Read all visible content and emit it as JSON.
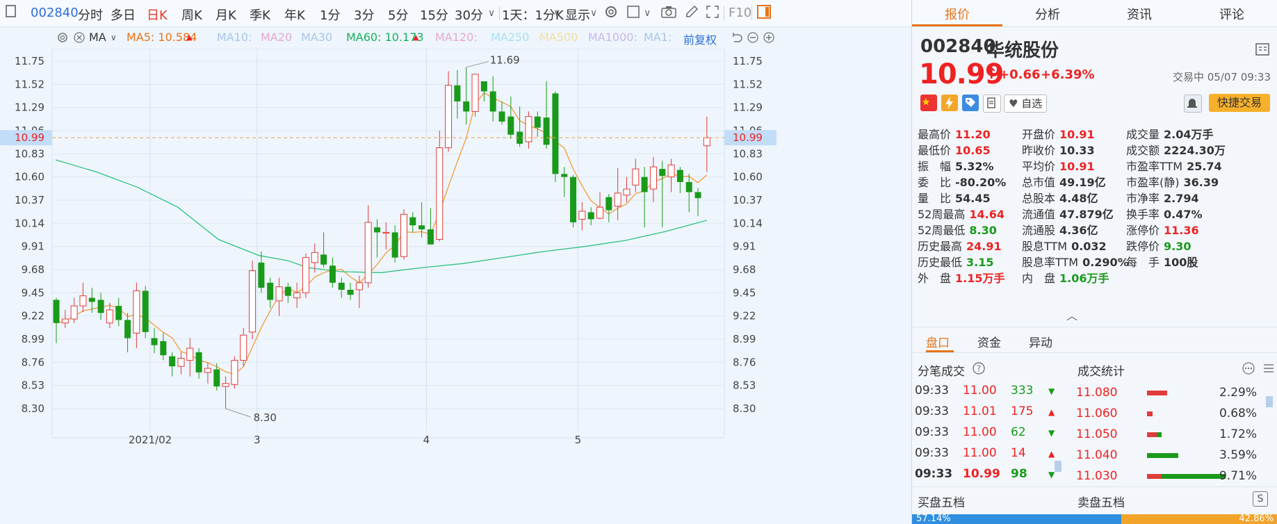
{
  "toolbar": {
    "code": "002840",
    "periods": [
      "分时",
      "多日",
      "日K",
      "周K",
      "月K",
      "季K",
      "年K",
      "1分",
      "3分",
      "5分",
      "15分",
      "30分"
    ],
    "active_period": "日K",
    "interval_select": "1天：1分K",
    "display_menu": "显示",
    "f10": "F10"
  },
  "ma_row": {
    "type_select": "MA",
    "ma5": "MA5: 10.584",
    "ma10": "MA10:",
    "ma20": "MA20",
    "ma30": "MA30",
    "ma60": "MA60: 10.173",
    "ma120": "MA120:",
    "ma250": "MA250",
    "ma500": "MA500",
    "ma1000": "MA1000:",
    "ma1": "MA1:",
    "adjust": "前复权",
    "colors": {
      "ma5": "#e8731a",
      "ma60": "#19b05e",
      "faded": "#a9c6ea",
      "faded_pink": "#e6a9c8"
    }
  },
  "chart_data": {
    "type": "candlestick",
    "y_ticks": [
      11.75,
      11.52,
      11.29,
      11.06,
      10.83,
      10.6,
      10.37,
      10.14,
      9.91,
      9.68,
      9.45,
      9.22,
      8.99,
      8.76,
      8.53,
      8.3
    ],
    "ylim": [
      8.22,
      11.84
    ],
    "x_labels": [
      {
        "label": "2021/02",
        "index": 11
      },
      {
        "label": "3",
        "index": 23
      },
      {
        "label": "4",
        "index": 42
      },
      {
        "label": "5",
        "index": 59
      }
    ],
    "annotations": {
      "high": "11.69",
      "low": "8.30"
    },
    "current_price": "10.99",
    "candles": [
      [
        9.38,
        9.15,
        9.4,
        8.95
      ],
      [
        9.15,
        9.19,
        9.28,
        9.1
      ],
      [
        9.19,
        9.32,
        9.4,
        9.15
      ],
      [
        9.32,
        9.42,
        9.55,
        9.26
      ],
      [
        9.4,
        9.36,
        9.5,
        9.25
      ],
      [
        9.38,
        9.25,
        9.45,
        9.18
      ],
      [
        9.15,
        9.28,
        9.35,
        9.1
      ],
      [
        9.32,
        9.18,
        9.4,
        9.12
      ],
      [
        9.18,
        9.0,
        9.25,
        8.86
      ],
      [
        9.05,
        9.47,
        9.55,
        8.9
      ],
      [
        9.47,
        9.06,
        9.52,
        9.0
      ],
      [
        9.0,
        8.93,
        9.1,
        8.85
      ],
      [
        8.97,
        8.83,
        9.05,
        8.78
      ],
      [
        8.82,
        8.72,
        8.86,
        8.62
      ],
      [
        8.72,
        8.8,
        8.86,
        8.64
      ],
      [
        8.78,
        8.9,
        9.0,
        8.62
      ],
      [
        8.86,
        8.66,
        8.9,
        8.6
      ],
      [
        8.66,
        8.7,
        8.76,
        8.55
      ],
      [
        8.69,
        8.52,
        8.75,
        8.48
      ],
      [
        8.52,
        8.55,
        8.62,
        8.3
      ],
      [
        8.54,
        8.78,
        8.82,
        8.5
      ],
      [
        8.78,
        9.03,
        9.1,
        8.72
      ],
      [
        9.06,
        9.67,
        9.77,
        8.99
      ],
      [
        9.75,
        9.5,
        9.86,
        9.45
      ],
      [
        9.55,
        9.38,
        9.6,
        9.3
      ],
      [
        9.37,
        9.51,
        9.6,
        9.22
      ],
      [
        9.51,
        9.42,
        9.55,
        9.35
      ],
      [
        9.4,
        9.45,
        9.55,
        9.3
      ],
      [
        9.45,
        9.8,
        9.84,
        9.4
      ],
      [
        9.75,
        9.85,
        9.94,
        9.65
      ],
      [
        9.83,
        9.73,
        10.05,
        9.7
      ],
      [
        9.72,
        9.55,
        9.8,
        9.5
      ],
      [
        9.55,
        9.48,
        9.6,
        9.4
      ],
      [
        9.48,
        9.43,
        9.55,
        9.38
      ],
      [
        9.48,
        9.55,
        9.62,
        9.3
      ],
      [
        9.55,
        10.15,
        10.32,
        9.5
      ],
      [
        10.1,
        10.05,
        10.18,
        9.8
      ],
      [
        10.05,
        10.05,
        10.15,
        9.88
      ],
      [
        10.05,
        9.8,
        10.12,
        9.75
      ],
      [
        9.81,
        10.23,
        10.28,
        9.78
      ],
      [
        10.2,
        10.12,
        10.25,
        10.05
      ],
      [
        10.12,
        10.08,
        10.35,
        10.0
      ],
      [
        10.08,
        9.93,
        10.29,
        9.95
      ],
      [
        9.98,
        10.89,
        11.06,
        9.96
      ],
      [
        10.89,
        11.51,
        11.65,
        10.85
      ],
      [
        11.51,
        11.35,
        11.66,
        11.18
      ],
      [
        11.35,
        11.25,
        11.69,
        11.12
      ],
      [
        11.25,
        11.62,
        11.62,
        11.2
      ],
      [
        11.55,
        11.45,
        11.55,
        11.35
      ],
      [
        11.45,
        11.25,
        11.6,
        11.15
      ],
      [
        11.25,
        11.15,
        11.35,
        11.12
      ],
      [
        11.2,
        11.02,
        11.4,
        10.98
      ],
      [
        11.05,
        10.93,
        11.3,
        10.9
      ],
      [
        10.95,
        11.2,
        11.25,
        10.88
      ],
      [
        11.2,
        11.09,
        11.25,
        11.0
      ],
      [
        11.19,
        10.92,
        11.55,
        10.88
      ],
      [
        11.43,
        10.63,
        11.45,
        10.55
      ],
      [
        10.63,
        10.6,
        10.7,
        10.4
      ],
      [
        10.6,
        10.15,
        10.62,
        10.1
      ],
      [
        10.18,
        10.26,
        10.35,
        10.07
      ],
      [
        10.25,
        10.18,
        10.3,
        10.12
      ],
      [
        10.19,
        10.3,
        10.45,
        10.18
      ],
      [
        10.4,
        10.27,
        10.43,
        10.15
      ],
      [
        10.31,
        10.44,
        10.69,
        10.17
      ],
      [
        10.42,
        10.48,
        10.6,
        10.35
      ],
      [
        10.52,
        10.68,
        10.78,
        10.45
      ],
      [
        10.6,
        10.45,
        10.7,
        10.1
      ],
      [
        10.48,
        10.7,
        10.8,
        10.35
      ],
      [
        10.68,
        10.61,
        10.76,
        10.1
      ],
      [
        10.6,
        10.72,
        10.78,
        10.45
      ],
      [
        10.67,
        10.55,
        10.7,
        10.44
      ],
      [
        10.55,
        10.45,
        10.63,
        10.25
      ],
      [
        10.45,
        10.39,
        10.49,
        10.21
      ],
      [
        10.91,
        10.99,
        11.2,
        10.65
      ]
    ],
    "ma60_points": [
      [
        0,
        10.77
      ],
      [
        10,
        10.65
      ],
      [
        20,
        10.5
      ],
      [
        30,
        10.3
      ],
      [
        40,
        9.98
      ],
      [
        50,
        9.82
      ],
      [
        57,
        9.77
      ],
      [
        62,
        9.7
      ],
      [
        70,
        9.66
      ],
      [
        80,
        9.65
      ],
      [
        90,
        9.7
      ],
      [
        100,
        9.74
      ],
      [
        110,
        9.8
      ],
      [
        120,
        9.86
      ],
      [
        130,
        9.91
      ],
      [
        140,
        9.97
      ],
      [
        150,
        10.06
      ],
      [
        160,
        10.17
      ]
    ]
  },
  "right_panel": {
    "tabs": [
      "报价",
      "分析",
      "资讯",
      "评论"
    ],
    "active_tab": "报价",
    "code": "002840",
    "name": "华统股份",
    "price": "10.99",
    "change": "+0.66",
    "change_pct": "+6.39%",
    "state": "交易中 05/07 09:33",
    "watch_button": "自选",
    "quick_trade": "快捷交易",
    "stats_col1": [
      {
        "k": "最高价",
        "v": "11.20",
        "c": "red"
      },
      {
        "k": "最低价",
        "v": "10.65",
        "c": "red"
      },
      {
        "k": "振　幅",
        "v": "5.32%",
        "c": "dark"
      },
      {
        "k": "委　比",
        "v": "-80.20%",
        "c": "dark"
      },
      {
        "k": "量　比",
        "v": "54.45",
        "c": "dark"
      },
      {
        "k": "52周最高",
        "v": "14.64",
        "c": "red"
      },
      {
        "k": "52周最低",
        "v": "8.30",
        "c": "green"
      },
      {
        "k": "历史最高",
        "v": "24.91",
        "c": "red"
      },
      {
        "k": "历史最低",
        "v": "3.15",
        "c": "green"
      },
      {
        "k": "外　盘",
        "v": "1.15万手",
        "c": "red"
      }
    ],
    "stats_col2": [
      {
        "k": "开盘价",
        "v": "10.91",
        "c": "red"
      },
      {
        "k": "昨收价",
        "v": "10.33",
        "c": "dark"
      },
      {
        "k": "平均价",
        "v": "10.91",
        "c": "red"
      },
      {
        "k": "总市值",
        "v": "49.19亿",
        "c": "dark"
      },
      {
        "k": "总股本",
        "v": "4.48亿",
        "c": "dark"
      },
      {
        "k": "流通值",
        "v": "47.879亿",
        "c": "dark"
      },
      {
        "k": "流通股",
        "v": "4.36亿",
        "c": "dark"
      },
      {
        "k": "股息TTM",
        "v": "0.032",
        "c": "dark"
      },
      {
        "k": "股息率TTM",
        "v": "0.290%",
        "c": "dark"
      },
      {
        "k": "内　盘",
        "v": "1.06万手",
        "c": "green"
      }
    ],
    "stats_col3": [
      {
        "k": "成交量",
        "v": "2.04万手",
        "c": "dark"
      },
      {
        "k": "成交额",
        "v": "2224.30万",
        "c": "dark"
      },
      {
        "k": "市盈率TTM",
        "v": "25.74",
        "c": "dark"
      },
      {
        "k": "市盈率(静)",
        "v": "36.39",
        "c": "dark"
      },
      {
        "k": "市净率",
        "v": "2.794",
        "c": "dark"
      },
      {
        "k": "换手率",
        "v": "0.47%",
        "c": "dark"
      },
      {
        "k": "涨停价",
        "v": "11.36",
        "c": "red"
      },
      {
        "k": "跌停价",
        "v": "9.30",
        "c": "green"
      },
      {
        "k": "每　手",
        "v": "100股",
        "c": "dark"
      }
    ],
    "sub_tabs": [
      "盘口",
      "资金",
      "异动"
    ],
    "active_sub_tab": "盘口",
    "ticks_title": "分笔成交",
    "ticks": [
      {
        "time": "09:33",
        "price": "11.00",
        "vol": "333",
        "dir": "down"
      },
      {
        "time": "09:33",
        "price": "11.01",
        "vol": "175",
        "dir": "up"
      },
      {
        "time": "09:33",
        "price": "11.00",
        "vol": "62",
        "dir": "down"
      },
      {
        "time": "09:33",
        "price": "11.00",
        "vol": "14",
        "dir": "up"
      },
      {
        "time": "09:33",
        "price": "10.99",
        "vol": "98",
        "dir": "down"
      }
    ],
    "volstats_title": "成交统计",
    "volstats": [
      {
        "price": "11.080",
        "pct": "2.29%",
        "r": 0.62,
        "g": 0.0
      },
      {
        "price": "11.060",
        "pct": "0.68%",
        "r": 0.18,
        "g": 0.0
      },
      {
        "price": "11.050",
        "pct": "1.72%",
        "r": 0.3,
        "g": 0.15
      },
      {
        "price": "11.040",
        "pct": "3.59%",
        "r": 0.0,
        "g": 0.97
      },
      {
        "price": "11.030",
        "pct": "9.71%",
        "r": 0.45,
        "g": 2.0
      }
    ],
    "bid_title": "买盘五档",
    "ask_title": "卖盘五档",
    "bid_pct": "57.14%",
    "ask_pct": "42.86%"
  }
}
